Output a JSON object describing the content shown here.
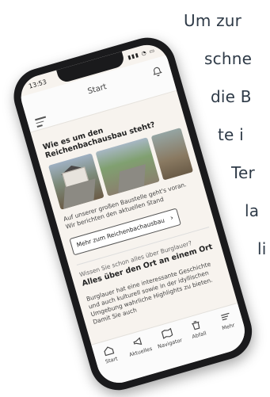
{
  "promo": {
    "lines": [
      "Um zur",
      "schne",
      "die B",
      "te i",
      "Ter",
      "la",
      "li"
    ]
  },
  "status": {
    "time": "13:53"
  },
  "header": {
    "title": "Start"
  },
  "card": {
    "title": "Wie es um den Reichenbachausbau steht?",
    "text": "Auf unserer großen Baustelle geht's voran. Wir berichten den aktuellen Stand",
    "button_label": "Mehr zum Reichenbachausbau"
  },
  "info": {
    "kicker": "Wissen Sie schon alles über Burglauer?",
    "title": "Alles über den Ort an einem Ort",
    "text": "Burglauer hat eine interessante Geschichte und auch kulturell sowie in der idyllischen Umgebung wahrliche Highlights zu bieten. Damit Sie auch"
  },
  "tabs": [
    {
      "label": "Start",
      "icon": "home-icon"
    },
    {
      "label": "Aktuelles",
      "icon": "megaphone-icon"
    },
    {
      "label": "Navigator",
      "icon": "map-icon"
    },
    {
      "label": "Abfall",
      "icon": "trash-icon"
    },
    {
      "label": "Mehr",
      "icon": "menu-icon"
    }
  ]
}
